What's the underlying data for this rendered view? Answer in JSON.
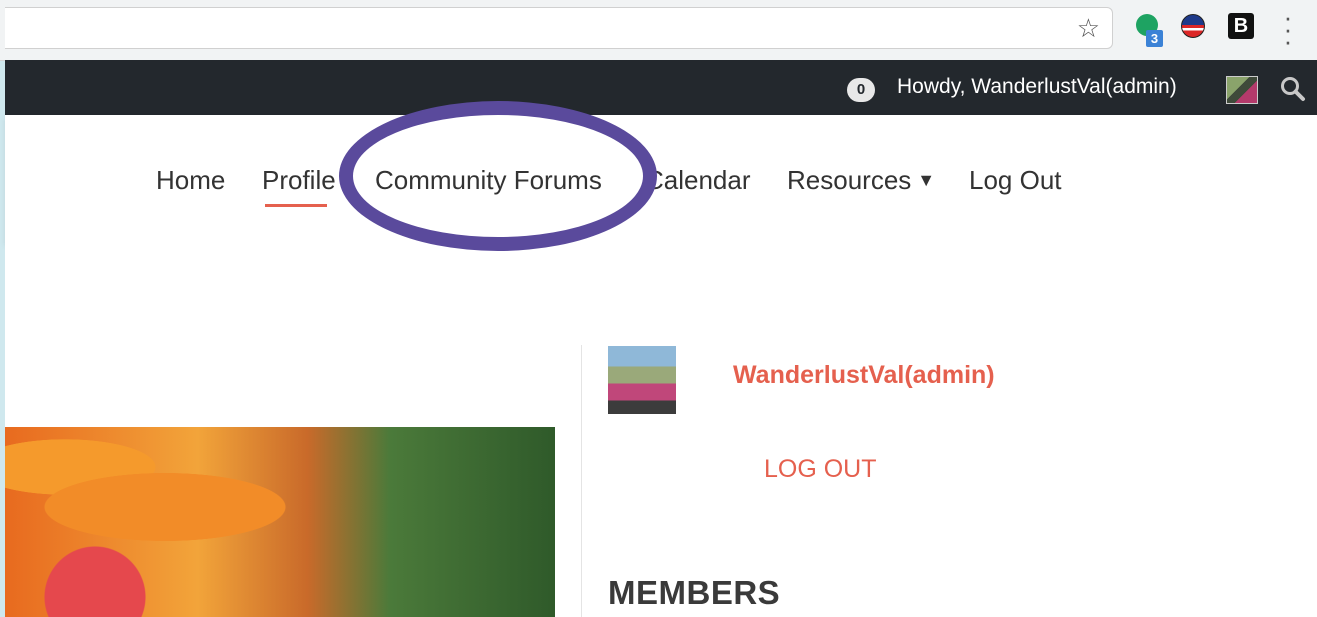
{
  "browser": {
    "ext_badge_count": "3",
    "ext_b_label": "B"
  },
  "admin_bar": {
    "notification_count": "0",
    "howdy_text": "Howdy, WanderlustVal(admin)"
  },
  "nav": {
    "items": [
      {
        "label": "Home"
      },
      {
        "label": "Profile"
      },
      {
        "label": "Community Forums"
      },
      {
        "label": "Calendar"
      },
      {
        "label": "Resources"
      },
      {
        "label": "Log Out"
      }
    ],
    "active": "Profile"
  },
  "sidebar": {
    "username": "WanderlustVal(admin)",
    "logout_label": "LOG OUT",
    "members_heading": "MEMBERS"
  },
  "colors": {
    "accent": "#e5604e",
    "admin_bar": "#23282d",
    "annotation": "#5a4a9c"
  },
  "icons": [
    "star-icon",
    "extension-green-icon",
    "extension-flag-icon",
    "extension-b-icon",
    "menu-dots-icon",
    "search-icon",
    "caret-down-icon"
  ]
}
